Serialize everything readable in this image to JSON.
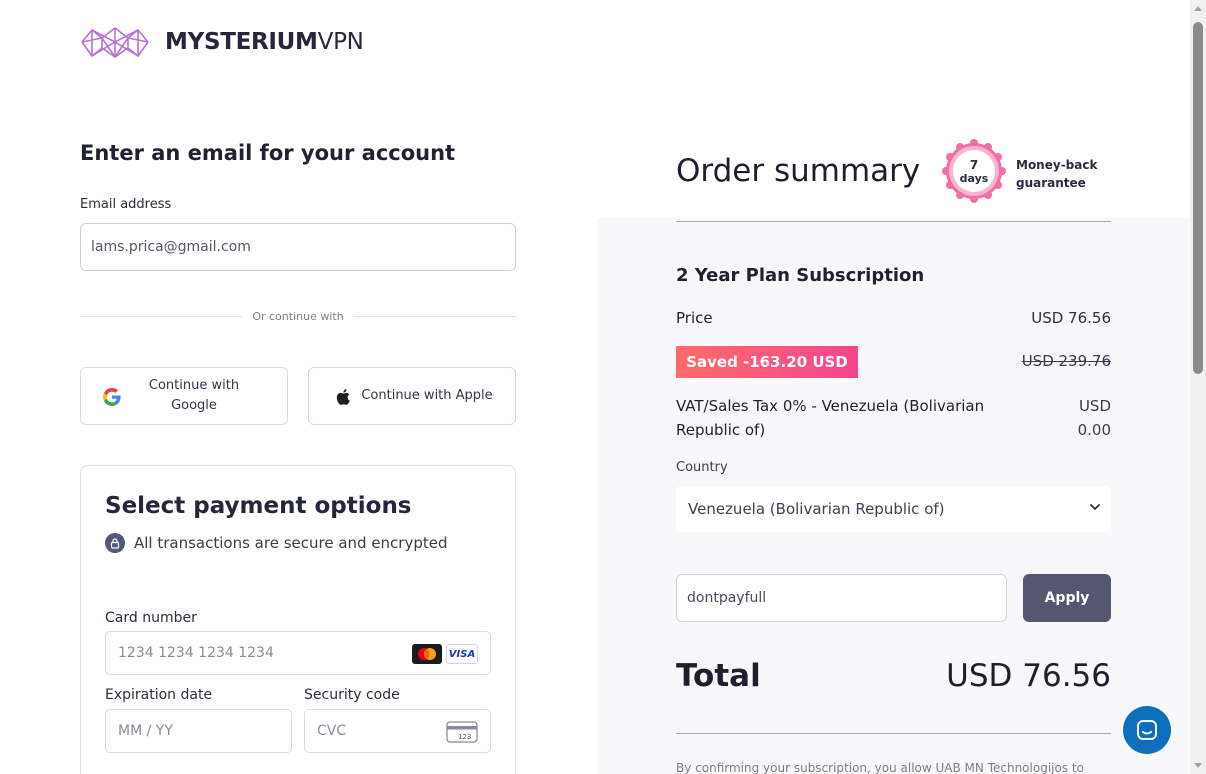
{
  "brand": {
    "name_bold": "MYSTERIUM",
    "name_light": "VPN",
    "logo_icon": "mysterium-logo-icon"
  },
  "account": {
    "heading": "Enter an email for your account",
    "email_label": "Email address",
    "email_value": "lams.prica@gmail.com",
    "divider_text": "Or continue with",
    "google_label": "Continue with Google",
    "apple_label": "Continue with Apple"
  },
  "payment": {
    "title": "Select payment options",
    "secure_text": "All transactions are secure and encrypted",
    "card_number_label": "Card number",
    "card_number_placeholder": "1234 1234 1234 1234",
    "visa_label": "VISA",
    "expiry_label": "Expiration date",
    "expiry_placeholder": "MM / YY",
    "cvc_label": "Security code",
    "cvc_placeholder": "CVC",
    "cvc_icon_text": "123"
  },
  "summary": {
    "title": "Order summary",
    "badge_number": "7",
    "badge_unit": "days",
    "guarantee_line1": "Money-back",
    "guarantee_line2": "guarantee",
    "plan_name": "2 Year Plan Subscription",
    "price_label": "Price",
    "price_value": "USD 76.56",
    "saved_text": "Saved -163.20 USD",
    "original_price": "USD 239.76",
    "vat_label": "VAT/Sales Tax 0% - Venezuela (Bolivarian Republic of)",
    "vat_currency": "USD",
    "vat_amount": "0.00",
    "country_label": "Country",
    "country_value": "Venezuela (Bolivarian Republic of)",
    "coupon_value": "dontpayfull",
    "apply_label": "Apply",
    "total_label": "Total",
    "total_value": "USD 76.56",
    "disclaimer": "By confirming your subscription, you allow UAB MN Technologijos to"
  },
  "colors": {
    "accent_purple": "#b86fd9",
    "saved_gradient_start": "#ff6b6b",
    "saved_gradient_end": "#f5458f",
    "apply_button": "#55566f",
    "chat_button": "#0c6fbd"
  }
}
